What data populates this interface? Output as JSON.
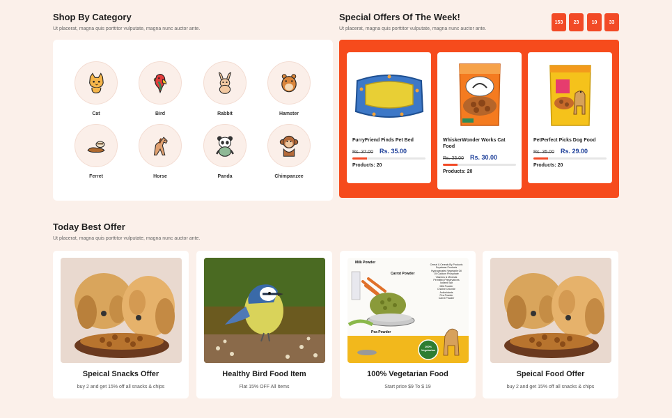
{
  "category": {
    "title": "Shop By Category",
    "subtitle": "Ut placerat, magna quis porttitor vulputate, magna nunc auctor ante.",
    "items": [
      {
        "label": "Cat",
        "icon": "cat-icon"
      },
      {
        "label": "Bird",
        "icon": "parrot-icon"
      },
      {
        "label": "Rabbit",
        "icon": "rabbit-icon"
      },
      {
        "label": "Hamster",
        "icon": "hamster-icon"
      },
      {
        "label": "Ferret",
        "icon": "ferret-icon"
      },
      {
        "label": "Horse",
        "icon": "horse-icon"
      },
      {
        "label": "Panda",
        "icon": "panda-icon"
      },
      {
        "label": "Chimpanzee",
        "icon": "chimpanzee-icon"
      }
    ]
  },
  "offers": {
    "title": "Special Offers Of The Week!",
    "subtitle": "Ut placerat, magna quis porttitor vulputate, magna nunc auctor ante.",
    "countdown": [
      "153",
      "23",
      "10",
      "33"
    ],
    "accent": "#f64b1c",
    "products": [
      {
        "name": "FurryFriend Finds Pet Bed",
        "old_price": "Rs. 37.00",
        "new_price": "Rs. 35.00",
        "stock": "Products: 20",
        "sold_fraction": 0.2
      },
      {
        "name": "WhiskerWonder Works Cat Food",
        "old_price": "Rs. 35.00",
        "new_price": "Rs. 30.00",
        "stock": "Products: 20",
        "sold_fraction": 0.2
      },
      {
        "name": "PetPerfect Picks Dog Food",
        "old_price": "Rs. 35.00",
        "new_price": "Rs. 29.00",
        "stock": "Products: 20",
        "sold_fraction": 0.2
      }
    ]
  },
  "best": {
    "title": "Today Best Offer",
    "subtitle": "Ut placerat, magna quis porttitor vulputate, magna nunc auctor ante.",
    "cards": [
      {
        "title": "Speical Snacks Offer",
        "sub": "buy 2 and get 15% off all snacks & chips"
      },
      {
        "title": "Healthy Bird Food Item",
        "sub": "Flat 15% OFF All Items"
      },
      {
        "title": "100% Vegetarian Food",
        "sub": "Start price $9 To $ 19"
      },
      {
        "title": "Speical Food Offer",
        "sub": "buy 2 and get 15% off all snacks & chips"
      }
    ],
    "poster": {
      "milk": "Milk Powder",
      "carrot": "Carrot Powder",
      "pea": "Pea Powder",
      "badge_top": "100%",
      "badge_bottom": "Vegetarian",
      "list": [
        "Cereal & Cereals By-Products",
        "Soyabean Products",
        "Hydrogenated Vegetable Oil",
        "Oil Calcium Phosphate",
        "Vitamins & Minerals",
        "Permitted Preservatives",
        "Iodized Salt",
        "Milk Powder",
        "Choline Chloride",
        "Antioxidants",
        "Pea Powder",
        "Carrot Powder"
      ]
    },
    "bag_logo": "Kitty"
  }
}
